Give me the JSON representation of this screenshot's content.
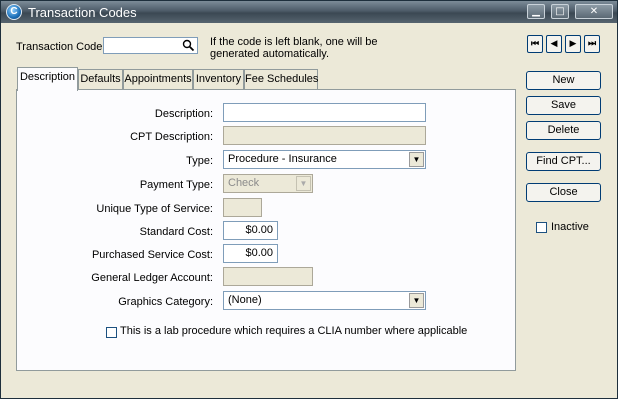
{
  "window": {
    "title": "Transaction Codes",
    "controls": {
      "minimize": "▁",
      "maximize": "□",
      "close": "✕"
    }
  },
  "header": {
    "code_label": "Transaction Code:",
    "code_value": "",
    "hint_line1": "If the code is left blank, one will be",
    "hint_line2": "generated automatically.",
    "nav": {
      "first": "⏮",
      "prev": "◀",
      "next": "▶",
      "last": "⏭"
    }
  },
  "tabs": [
    {
      "label": "Description",
      "active": true
    },
    {
      "label": "Defaults"
    },
    {
      "label": "Appointments"
    },
    {
      "label": "Inventory"
    },
    {
      "label": "Fee Schedules"
    }
  ],
  "form": {
    "description": {
      "label": "Description:",
      "value": ""
    },
    "cpt_description": {
      "label": "CPT Description:",
      "value": ""
    },
    "type": {
      "label": "Type:",
      "value": "Procedure - Insurance"
    },
    "payment_type": {
      "label": "Payment Type:",
      "value": "Check"
    },
    "unique_type_of_service": {
      "label": "Unique Type of Service:",
      "value": ""
    },
    "standard_cost": {
      "label": "Standard Cost:",
      "value": "$0.00"
    },
    "purchased_service_cost": {
      "label": "Purchased Service Cost:",
      "value": "$0.00"
    },
    "general_ledger_account": {
      "label": "General Ledger Account:",
      "value": ""
    },
    "graphics_category": {
      "label": "Graphics Category:",
      "value": "(None)"
    },
    "clia_checkbox": {
      "label": "This is a lab procedure which requires a CLIA number where applicable",
      "checked": false
    }
  },
  "buttons": {
    "new": "New",
    "save": "Save",
    "delete": "Delete",
    "find_cpt": "Find CPT...",
    "close": "Close"
  },
  "inactive": {
    "label": "Inactive",
    "checked": false
  },
  "icons": {
    "search": "search-icon",
    "dropdown": "chevron-down-icon"
  }
}
